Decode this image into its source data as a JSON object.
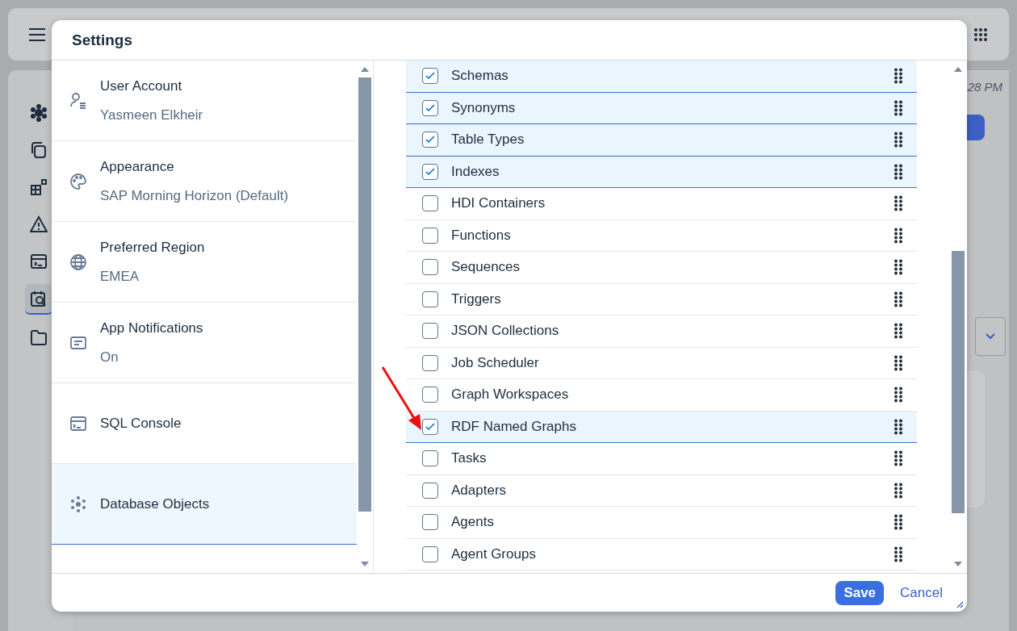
{
  "shell": {
    "time": "28 PM",
    "nav": [
      {
        "selected": false
      },
      {
        "selected": false
      },
      {
        "selected": false
      },
      {
        "selected": false
      },
      {
        "selected": false
      },
      {
        "selected": true
      },
      {
        "selected": false
      }
    ]
  },
  "dialog": {
    "title": "Settings",
    "categories": [
      {
        "label": "User Account",
        "value": "Yasmeen Elkheir",
        "selected": false
      },
      {
        "label": "Appearance",
        "value": "SAP Morning Horizon (Default)",
        "selected": false
      },
      {
        "label": "Preferred Region",
        "value": "EMEA",
        "selected": false
      },
      {
        "label": "App Notifications",
        "value": "On",
        "selected": false
      },
      {
        "label": "SQL Console",
        "selected": false
      },
      {
        "label": "Database Objects",
        "selected": true
      }
    ],
    "objects": [
      {
        "label": "Schemas",
        "checked": true
      },
      {
        "label": "Synonyms",
        "checked": true
      },
      {
        "label": "Table Types",
        "checked": true
      },
      {
        "label": "Indexes",
        "checked": true
      },
      {
        "label": "HDI Containers",
        "checked": false
      },
      {
        "label": "Functions",
        "checked": false
      },
      {
        "label": "Sequences",
        "checked": false
      },
      {
        "label": "Triggers",
        "checked": false
      },
      {
        "label": "JSON Collections",
        "checked": false
      },
      {
        "label": "Job Scheduler",
        "checked": false
      },
      {
        "label": "Graph Workspaces",
        "checked": false
      },
      {
        "label": "RDF Named Graphs",
        "checked": true
      },
      {
        "label": "Tasks",
        "checked": false
      },
      {
        "label": "Adapters",
        "checked": false
      },
      {
        "label": "Agents",
        "checked": false
      },
      {
        "label": "Agent Groups",
        "checked": false
      }
    ],
    "buttons": {
      "save": "Save",
      "cancel": "Cancel"
    }
  }
}
